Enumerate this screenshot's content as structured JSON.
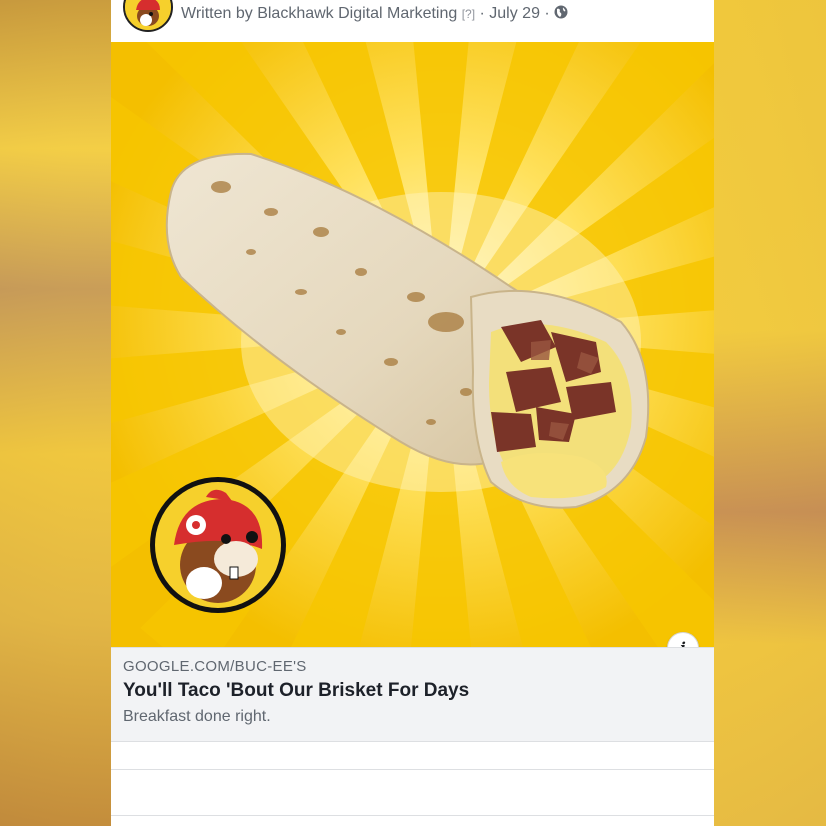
{
  "post": {
    "written_by_prefix": "Written by",
    "author": "Blackhawk Digital Marketing",
    "help_marker": "[?]",
    "separator1": " · ",
    "date": "July 29",
    "separator2": " · ",
    "privacy_icon": "globe-icon"
  },
  "image": {
    "subject": "breakfast burrito with brisket and eggs",
    "logo_icon": "beaver-mascot-logo"
  },
  "link_preview": {
    "domain": "GOOGLE.COM/BUC-EE'S",
    "title": "You'll Taco 'Bout Our Brisket For Days",
    "description": "Breakfast done right.",
    "info_label": "i"
  },
  "colors": {
    "card_bg": "#ffffff",
    "link_box_bg": "#f2f3f5",
    "burst_yellow": "#f5c400",
    "burst_light": "#ffe66a",
    "logo_red": "#d62e2e"
  }
}
